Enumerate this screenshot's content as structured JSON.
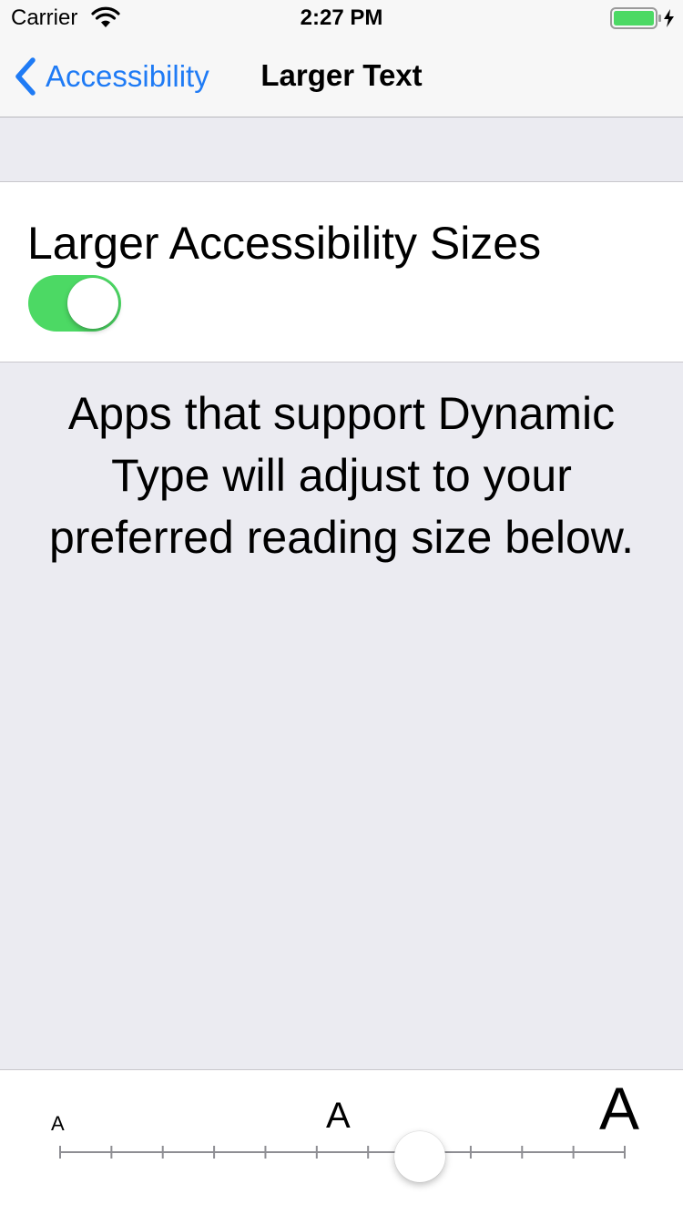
{
  "status_bar": {
    "carrier": "Carrier",
    "time": "2:27 PM",
    "battery_color": "#4cd964"
  },
  "nav": {
    "back_label": "Accessibility",
    "title": "Larger Text",
    "accent_color": "#1f7bf5"
  },
  "toggle_section": {
    "label": "Larger Accessibility Sizes",
    "toggle_on": true,
    "toggle_color": "#4cd964"
  },
  "description": "Apps that support Dynamic Type will adjust to your preferred reading size below.",
  "slider": {
    "small_label": "A",
    "medium_label": "A",
    "large_label": "A",
    "tick_count": 12,
    "selected_index": 7
  },
  "icons": {
    "back": "chevron-left-icon",
    "wifi": "wifi-icon",
    "battery": "battery-icon",
    "charging": "bolt-icon"
  }
}
